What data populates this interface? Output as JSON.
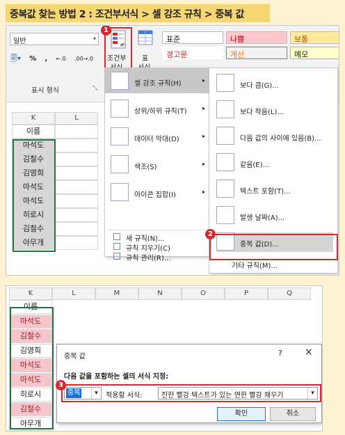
{
  "title": "중복값 찾는 방법 2 : 조건부서식 > 셀 강조 규칙 > 중복 값",
  "ribbon": {
    "number_format_value": "일반",
    "format_buttons": [
      "%",
      ",",
      "←.0",
      ".00→.0"
    ],
    "number_group_label": "표시 형식",
    "conditional_label_1": "조건부",
    "conditional_label_2": "서식",
    "table_label_1": "표",
    "table_label_2": "서식",
    "styles": {
      "normal": "표준",
      "bad": "나쁨",
      "neutral": "보통",
      "warning": "경고문",
      "calculation": "계산",
      "note": "메모"
    }
  },
  "badges": {
    "b1": "1",
    "b2": "2",
    "b3": "3"
  },
  "sheet1": {
    "columns": [
      "K",
      "L"
    ],
    "cells": [
      "이름",
      "마석도",
      "김철수",
      "김영희",
      "마석도",
      "마석도",
      "히로시",
      "김철수",
      "아무개"
    ]
  },
  "menu1": {
    "items": [
      "셀 강조 규칙(H)",
      "상위/하위 규칙(T)",
      "데이터 막대(D)",
      "색조(S)",
      "아이콘 집합(I)"
    ],
    "small_items": [
      "새 규칙(N)...",
      "규칙 지우기(C)",
      "규칙 관리(R)..."
    ]
  },
  "menu2": {
    "items": [
      "보다 큼(G)...",
      "보다 작음(L)...",
      "다음 값의 사이에 있음(B)...",
      "같음(E)...",
      "텍스트 포함(T)...",
      "발생 날짜(A)...",
      "중복 값(D)..."
    ],
    "more": "기타 규칙(M)..."
  },
  "sheet2": {
    "columns": [
      "K",
      "L",
      "M",
      "N",
      "O",
      "P",
      "Q"
    ],
    "cells": [
      "이름",
      "마석도",
      "김철수",
      "김영희",
      "마석도",
      "마석도",
      "히로시",
      "김철수",
      "아무개"
    ],
    "highlight": [
      false,
      true,
      true,
      false,
      true,
      true,
      false,
      true,
      false
    ]
  },
  "dialog": {
    "title": "중복 값",
    "help": "?",
    "close": "×",
    "instruction": "다음 값을 포함하는 셀의 서식 지정:",
    "type_value": "중복",
    "apply_label": "적용할 서식:",
    "format_value": "진한 빨강 텍스트가 있는 연한 빨강 채우기",
    "ok": "확인",
    "cancel": "취소"
  },
  "colors": {
    "accent_red": "#d9262c",
    "dup_fill": "#f6c6cc",
    "dup_text": "#9c1c21",
    "title_bg": "#f7d774"
  }
}
